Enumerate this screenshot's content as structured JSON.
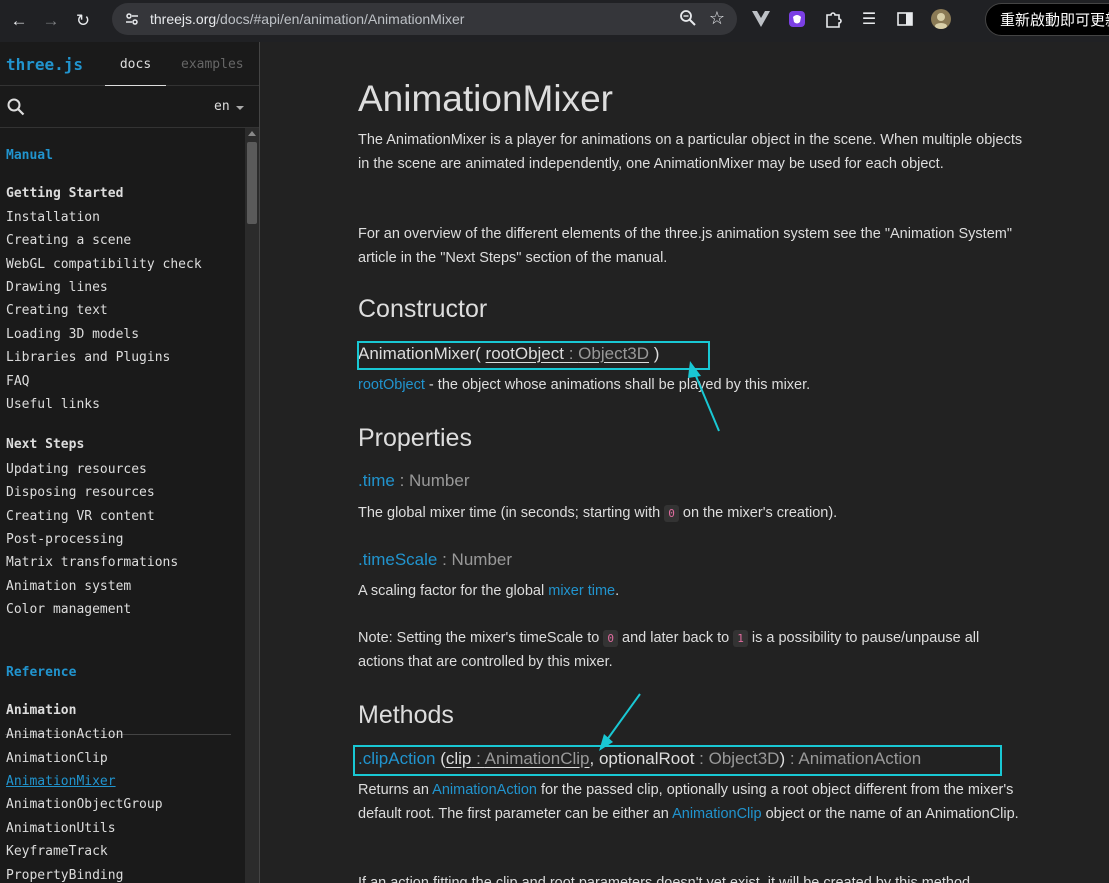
{
  "browser": {
    "url_host": "threejs.org",
    "url_path": "/docs/#api/en/animation/AnimationMixer",
    "restart_label": "重新啟動即可更新"
  },
  "sidebar": {
    "brand": "three.js",
    "tabs": [
      "docs",
      "examples"
    ],
    "language": "en",
    "items": [
      {
        "text": "Manual",
        "kind": "section"
      },
      {
        "text": "Getting Started",
        "kind": "group"
      },
      {
        "text": "Installation",
        "kind": "link"
      },
      {
        "text": "Creating a scene",
        "kind": "link"
      },
      {
        "text": "WebGL compatibility check",
        "kind": "link"
      },
      {
        "text": "Drawing lines",
        "kind": "link"
      },
      {
        "text": "Creating text",
        "kind": "link"
      },
      {
        "text": "Loading 3D models",
        "kind": "link"
      },
      {
        "text": "Libraries and Plugins",
        "kind": "link"
      },
      {
        "text": "FAQ",
        "kind": "link"
      },
      {
        "text": "Useful links",
        "kind": "link"
      },
      {
        "text": "Next Steps",
        "kind": "group"
      },
      {
        "text": "Updating resources",
        "kind": "link"
      },
      {
        "text": "Disposing resources",
        "kind": "link"
      },
      {
        "text": "Creating VR content",
        "kind": "link"
      },
      {
        "text": "Post-processing",
        "kind": "link"
      },
      {
        "text": "Matrix transformations",
        "kind": "link"
      },
      {
        "text": "Animation system",
        "kind": "link"
      },
      {
        "text": "Color management",
        "kind": "link"
      },
      {
        "text": "Reference",
        "kind": "section"
      },
      {
        "text": "Animation",
        "kind": "group"
      },
      {
        "text": "AnimationAction",
        "kind": "link"
      },
      {
        "text": "AnimationClip",
        "kind": "link"
      },
      {
        "text": "AnimationMixer",
        "kind": "active"
      },
      {
        "text": "AnimationObjectGroup",
        "kind": "link"
      },
      {
        "text": "AnimationUtils",
        "kind": "link"
      },
      {
        "text": "KeyframeTrack",
        "kind": "link"
      },
      {
        "text": "PropertyBinding",
        "kind": "link"
      }
    ]
  },
  "doc": {
    "title": "AnimationMixer",
    "intro": "The AnimationMixer is a player for animations on a particular object in the scene. When multiple objects in the scene are animated independently, one AnimationMixer may be used for each object.",
    "overview": "For an overview of the different elements of the three.js animation system see the \"Animation System\" article in the \"Next Steps\" section of the manual.",
    "constructor_heading": "Constructor",
    "constructor_name": "AnimationMixer(",
    "constructor_param": "rootObject",
    "constructor_type": "Object3D",
    "constructor_close": ")",
    "root_param_link": "rootObject",
    "root_param_desc": " - the object whose animations shall be played by this mixer.",
    "properties_heading": "Properties",
    "time_name": ".time",
    "time_type": "Number",
    "time_desc_a": "The global mixer time (in seconds; starting with ",
    "time_code": "0",
    "time_desc_b": " on the mixer's creation).",
    "timescale_name": ".timeScale",
    "timescale_type": "Number",
    "timescale_desc_a": "A scaling factor for the global ",
    "timescale_link": "mixer time",
    "timescale_desc_b": ".",
    "note_a": "Note: Setting the mixer's timeScale to ",
    "note_code_a": "0",
    "note_b": " and later back to ",
    "note_code_b": "1",
    "note_c": " is a possibility to pause/unpause all actions that are controlled by this mixer.",
    "methods_heading": "Methods",
    "clip_name": ".clipAction",
    "clip_open": " (",
    "clip_param": "clip",
    "clip_param_type": "AnimationClip",
    "clip_param2": ", optionalRoot",
    "clip_param2_type": "Object3D",
    "clip_close": ")",
    "clip_return": "AnimationAction",
    "clip_desc_a": "Returns an ",
    "clip_desc_link1": "AnimationAction",
    "clip_desc_b": " for the passed clip, optionally using a root object different from the mixer's default root. The first parameter can be either an ",
    "clip_desc_link2": "AnimationClip",
    "clip_desc_c": " object or the name of an AnimationClip.",
    "cut_line": "If an action fitting the clip and root parameters doesn't yet exist, it will be created by this method."
  },
  "colors": {
    "accent": "#2194ce",
    "annotation": "#19c8d4",
    "background": "#222222"
  }
}
